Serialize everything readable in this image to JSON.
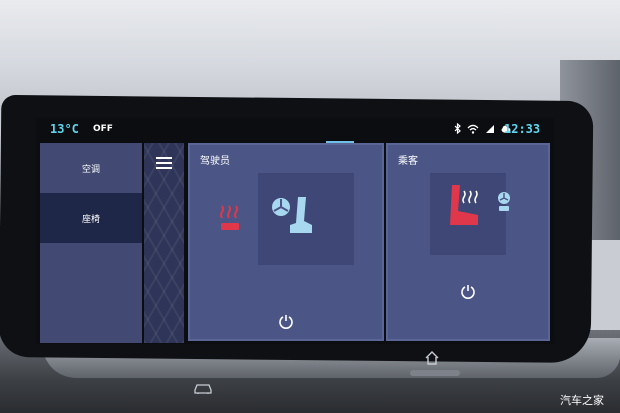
{
  "status_bar": {
    "temperature": "13°C",
    "ac_state": "OFF",
    "time": "12:33",
    "icons": [
      "bluetooth-icon",
      "wifi-icon",
      "signal-icon",
      "cloud-icon"
    ]
  },
  "menu": {
    "items": [
      {
        "label": "空调",
        "active": false
      },
      {
        "label": "座椅",
        "active": true
      }
    ]
  },
  "driver": {
    "title": "驾驶员",
    "heat_icon": "seat-heat-icon",
    "vent_icon": "seat-ventilation-icon",
    "heat_color": "#e0384a",
    "vent_color": "#a8d8ef"
  },
  "passenger": {
    "title": "乘客",
    "heat_icon": "seat-heat-icon",
    "vent_icon": "seat-ventilation-icon",
    "heat_color": "#e0384a",
    "vent_color": "#a8d8ef"
  },
  "colors": {
    "accent": "#5fd6f0",
    "panel": "#4b5686",
    "menu": "#424a74",
    "menu_active": "#1f2748"
  },
  "watermark": "汽车之家"
}
